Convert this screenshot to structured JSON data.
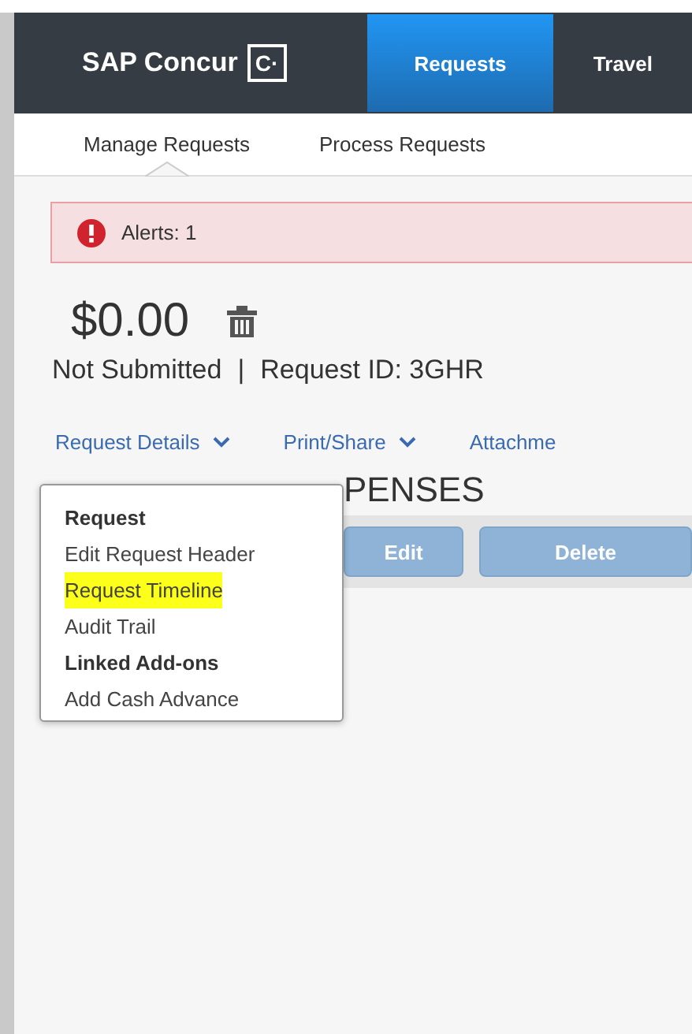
{
  "nav": {
    "logo": "SAP Concur",
    "logo_mark": "C·",
    "tabs": [
      {
        "label": "Requests",
        "selected": true
      },
      {
        "label": "Travel",
        "selected": false
      }
    ]
  },
  "subnav": [
    {
      "label": "Manage Requests",
      "selected": true
    },
    {
      "label": "Process Requests",
      "selected": false
    }
  ],
  "alert": {
    "text": "Alerts: 1"
  },
  "summary": {
    "amount": "$0.00",
    "status": "Not Submitted",
    "separator": "|",
    "request_id": "Request ID: 3GHR"
  },
  "actions": [
    {
      "label": "Request Details",
      "dropdown": true
    },
    {
      "label": "Print/Share",
      "dropdown": true
    },
    {
      "label": "Attachme",
      "dropdown": false
    }
  ],
  "expenses": {
    "heading": "PENSES",
    "buttons": [
      {
        "label": "Edit",
        "disabled": true
      },
      {
        "label": "Delete",
        "disabled": true
      }
    ]
  },
  "menu": [
    {
      "kind": "header",
      "label": "Request",
      "highlighted": false
    },
    {
      "kind": "link",
      "label": "Edit Request Header",
      "highlighted": false
    },
    {
      "kind": "link",
      "label": "Request Timeline",
      "highlighted": true
    },
    {
      "kind": "link",
      "label": "Audit Trail",
      "highlighted": false
    },
    {
      "kind": "header",
      "label": "Linked Add-ons",
      "highlighted": false
    },
    {
      "kind": "link",
      "label": "Add Cash Advance",
      "highlighted": false
    }
  ]
}
